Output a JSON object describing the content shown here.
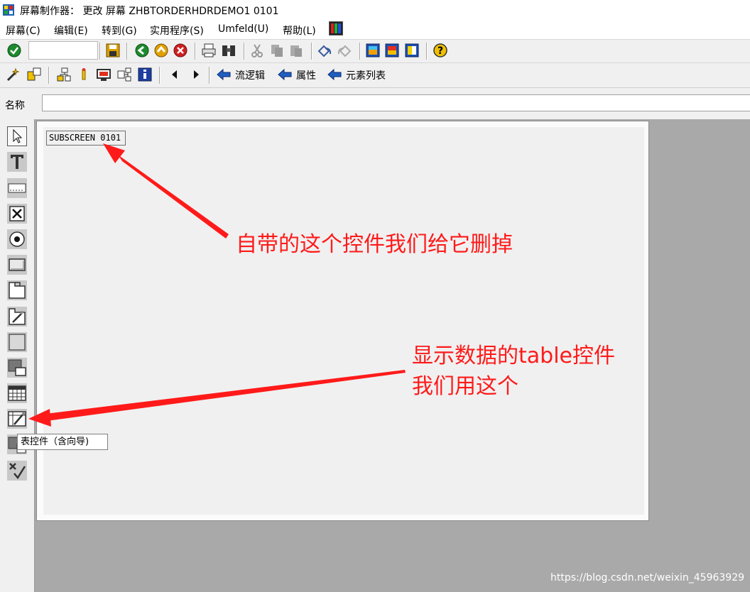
{
  "window": {
    "title": "屏幕制作器： 更改 屏幕 ZHBTORDERHDRDEMO1 0101"
  },
  "menu": {
    "items": [
      {
        "label": "屏幕(C)"
      },
      {
        "label": "编辑(E)"
      },
      {
        "label": "转到(G)"
      },
      {
        "label": "实用程序(S)"
      },
      {
        "label": "Umfeld(U)"
      },
      {
        "label": "帮助(L)"
      }
    ]
  },
  "toolbar2": {
    "flow_logic": "流逻辑",
    "attributes": "属性",
    "element_list": "元素列表"
  },
  "name_row": {
    "label": "名称",
    "value": ""
  },
  "canvas": {
    "subscreen_label": "SUBSCREEN 0101"
  },
  "tooltip": {
    "text": "表控件（含向导)"
  },
  "annotations": {
    "delete_note": "自带的这个控件我们给它删掉",
    "table_note_line1": "显示数据的table控件",
    "table_note_line2": "我们用这个"
  },
  "watermark": "https://blog.csdn.net/weixin_45963929",
  "colors": {
    "annotation": "#ff1a1a",
    "work_area": "#a9a9a9",
    "panel": "#f0f0f0"
  },
  "icons": {
    "toolbar1": [
      "check-icon",
      "save-icon",
      "back-icon",
      "exit-icon",
      "cancel-icon",
      "print-icon",
      "find-icon",
      "cut-icon",
      "copy-icon",
      "paste-icon",
      "undo-icon",
      "redo-icon",
      "layout-icon-1",
      "layout-icon-2",
      "layout-icon-3",
      "help-icon"
    ],
    "toolbar2": [
      "wand-icon",
      "display-change-icon",
      "hierarchy-icon",
      "bulb-icon",
      "screen-icon",
      "share-icon",
      "info-icon",
      "arrow-left-icon",
      "arrow-right-icon"
    ],
    "palette": [
      "pointer-icon",
      "text-field-icon",
      "input-field-icon",
      "checkbox-icon",
      "radio-button-icon",
      "pushbutton-icon",
      "tabstrip-icon",
      "tabstrip-wizard-icon",
      "box-icon",
      "subscreen-icon",
      "table-control-icon",
      "table-control-wizard-icon",
      "custom-control-icon",
      "status-icon"
    ]
  }
}
